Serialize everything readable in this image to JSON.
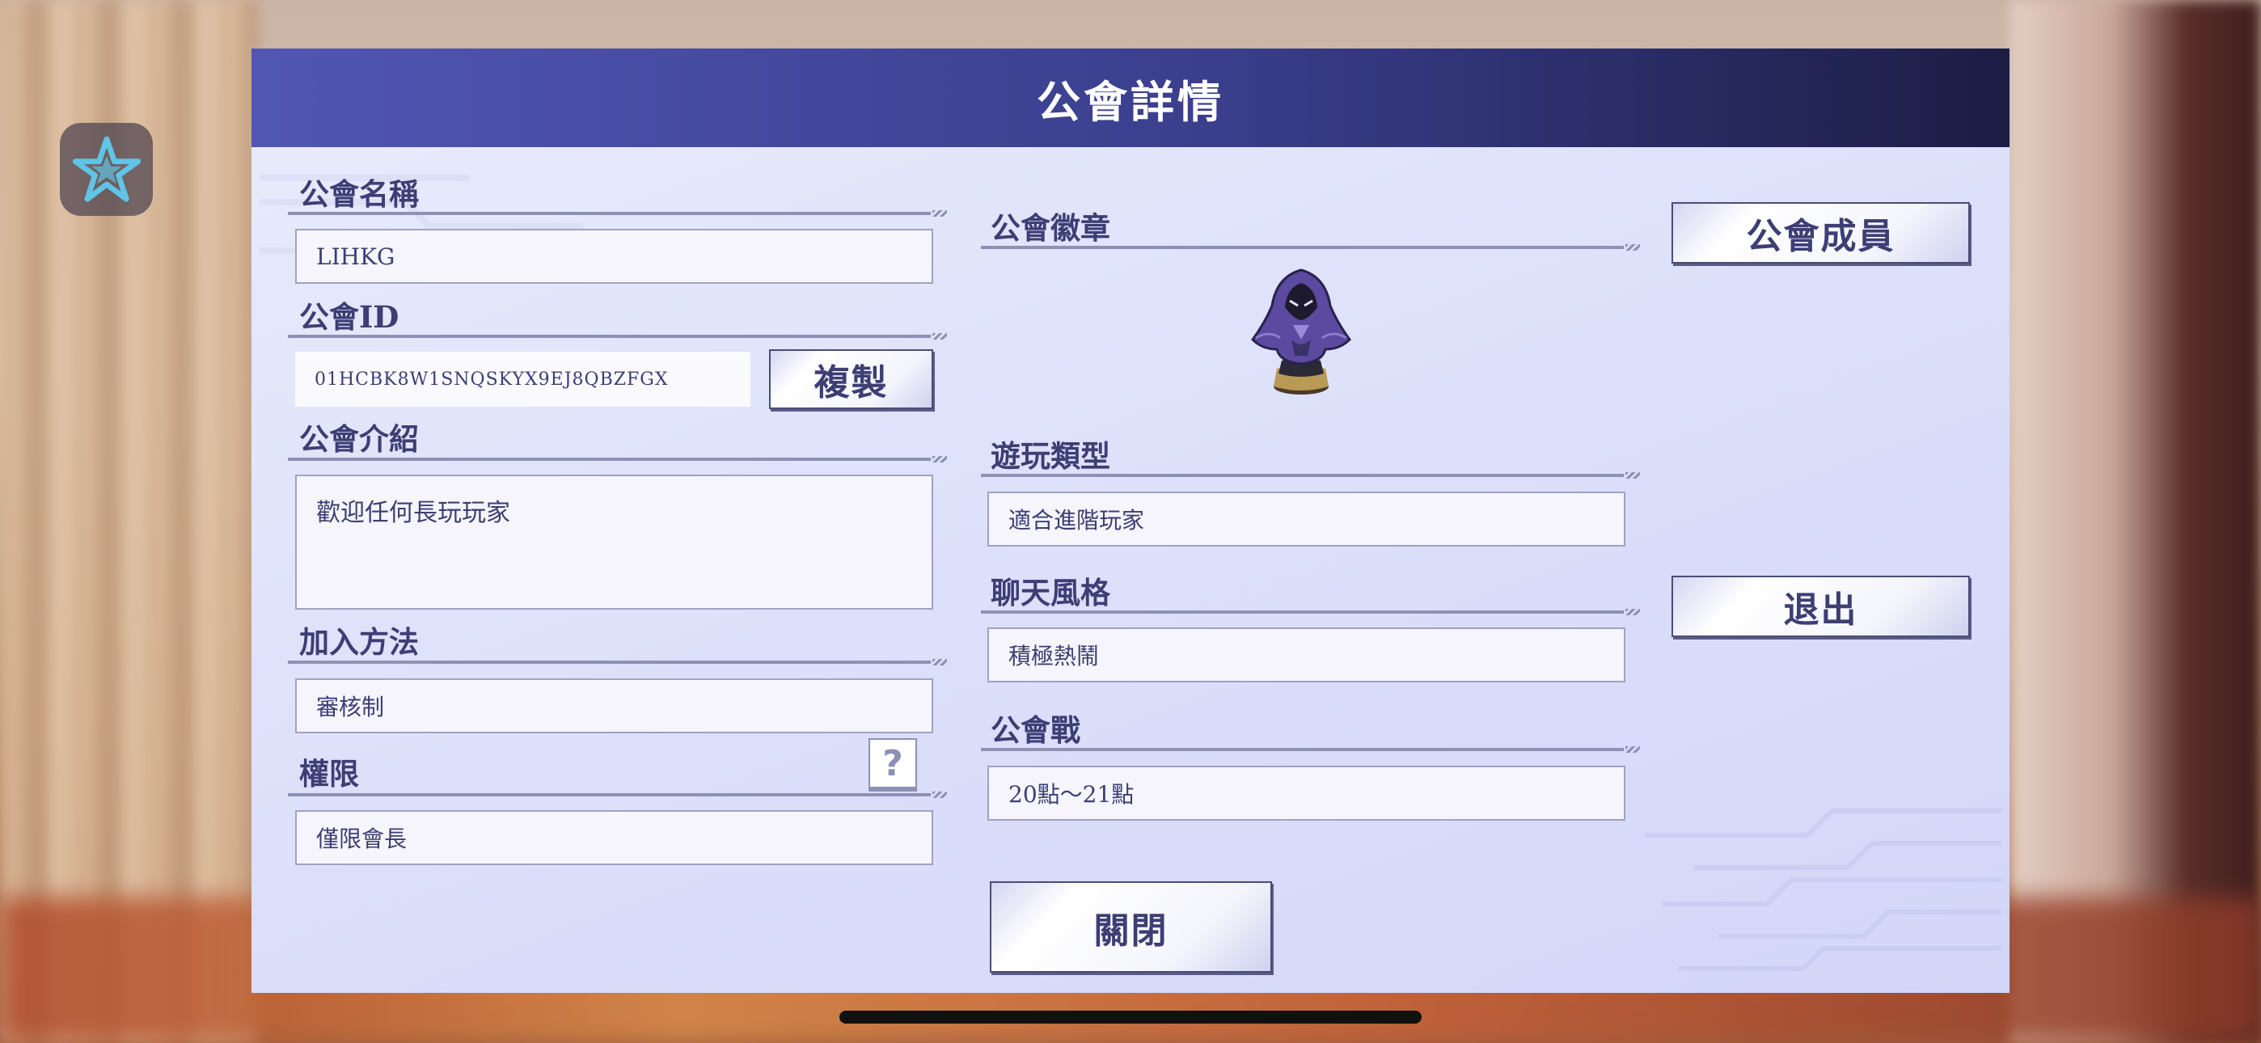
{
  "dialog": {
    "title": "公會詳情"
  },
  "guild_name": {
    "label": "公會名稱",
    "value": "LIHKG"
  },
  "guild_id": {
    "label": "公會ID",
    "value": "01HCBK8W1SNQSKYX9EJ8QBZFGX",
    "copy_label": "複製"
  },
  "guild_intro": {
    "label": "公會介紹",
    "value": "歡迎任何長玩玩家"
  },
  "join_method": {
    "label": "加入方法",
    "value": "審核制"
  },
  "permission": {
    "label": "權限",
    "value": "僅限會長",
    "help_label": "?"
  },
  "guild_emblem": {
    "label": "公會徽章",
    "icon": "hooded-figure-emblem-icon"
  },
  "play_type": {
    "label": "遊玩類型",
    "value": "適合進階玩家"
  },
  "chat_style": {
    "label": "聊天風格",
    "value": "積極熱鬧"
  },
  "guild_war": {
    "label": "公會戰",
    "value": "20點～21點"
  },
  "buttons": {
    "members": "公會成員",
    "leave": "退出",
    "close": "關閉"
  },
  "side": {
    "icon": "star-icon"
  },
  "colors": {
    "header_start": "#5156b4",
    "header_end": "#1c1d44",
    "label": "#3c3e74",
    "panel": "#dfe2fa"
  }
}
